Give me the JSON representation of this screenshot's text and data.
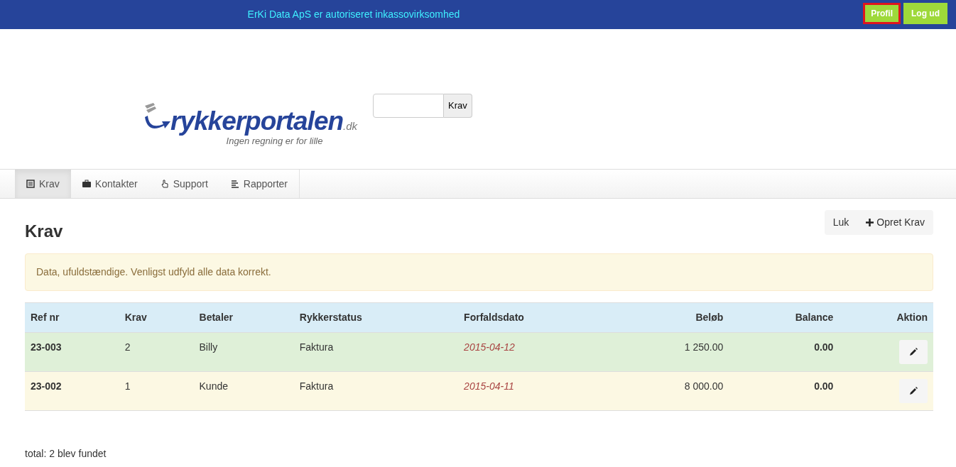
{
  "top_bar": {
    "notice": "ErKi Data ApS er autoriseret inkassovirksomhed",
    "buttons": [
      {
        "label": "Profil",
        "selected": true
      },
      {
        "label": "Log ud",
        "selected": false
      }
    ]
  },
  "logo": {
    "name": "rykkerportalen",
    "suffix": ".dk",
    "tagline": "Ingen regning er for lille"
  },
  "search": {
    "button": "Krav"
  },
  "nav": [
    {
      "label": "Krav",
      "kind": "list",
      "selected": true
    },
    {
      "label": "Kontakter",
      "kind": "briefcase",
      "selected": false
    },
    {
      "label": "Support",
      "kind": "hand",
      "selected": false
    },
    {
      "label": "Rapporter",
      "kind": "lines",
      "selected": false
    }
  ],
  "page": {
    "title": "Krav",
    "actions": [
      {
        "label": "Luk",
        "kind": "plain"
      },
      {
        "label": "Opret Krav",
        "kind": "plus"
      }
    ]
  },
  "alert": "Data, ufuldstændige. Venligst udfyld alle data korrekt.",
  "table": {
    "columns": [
      "Ref nr",
      "Krav",
      "Betaler",
      "Rykkerstatus",
      "Forfaldsdato",
      "Beløb",
      "Balance",
      "Aktion"
    ],
    "rows": [
      {
        "kind": "success",
        "cells": [
          "23-003",
          "2",
          "Billy",
          "Faktura",
          "2015-04-12",
          "1 250.00",
          "0.00"
        ]
      },
      {
        "kind": "warning",
        "cells": [
          "23-002",
          "1",
          "Kunde",
          "Faktura",
          "2015-04-11",
          "8 000.00",
          "0.00"
        ]
      }
    ]
  },
  "footer": "total: 2 blev fundet"
}
